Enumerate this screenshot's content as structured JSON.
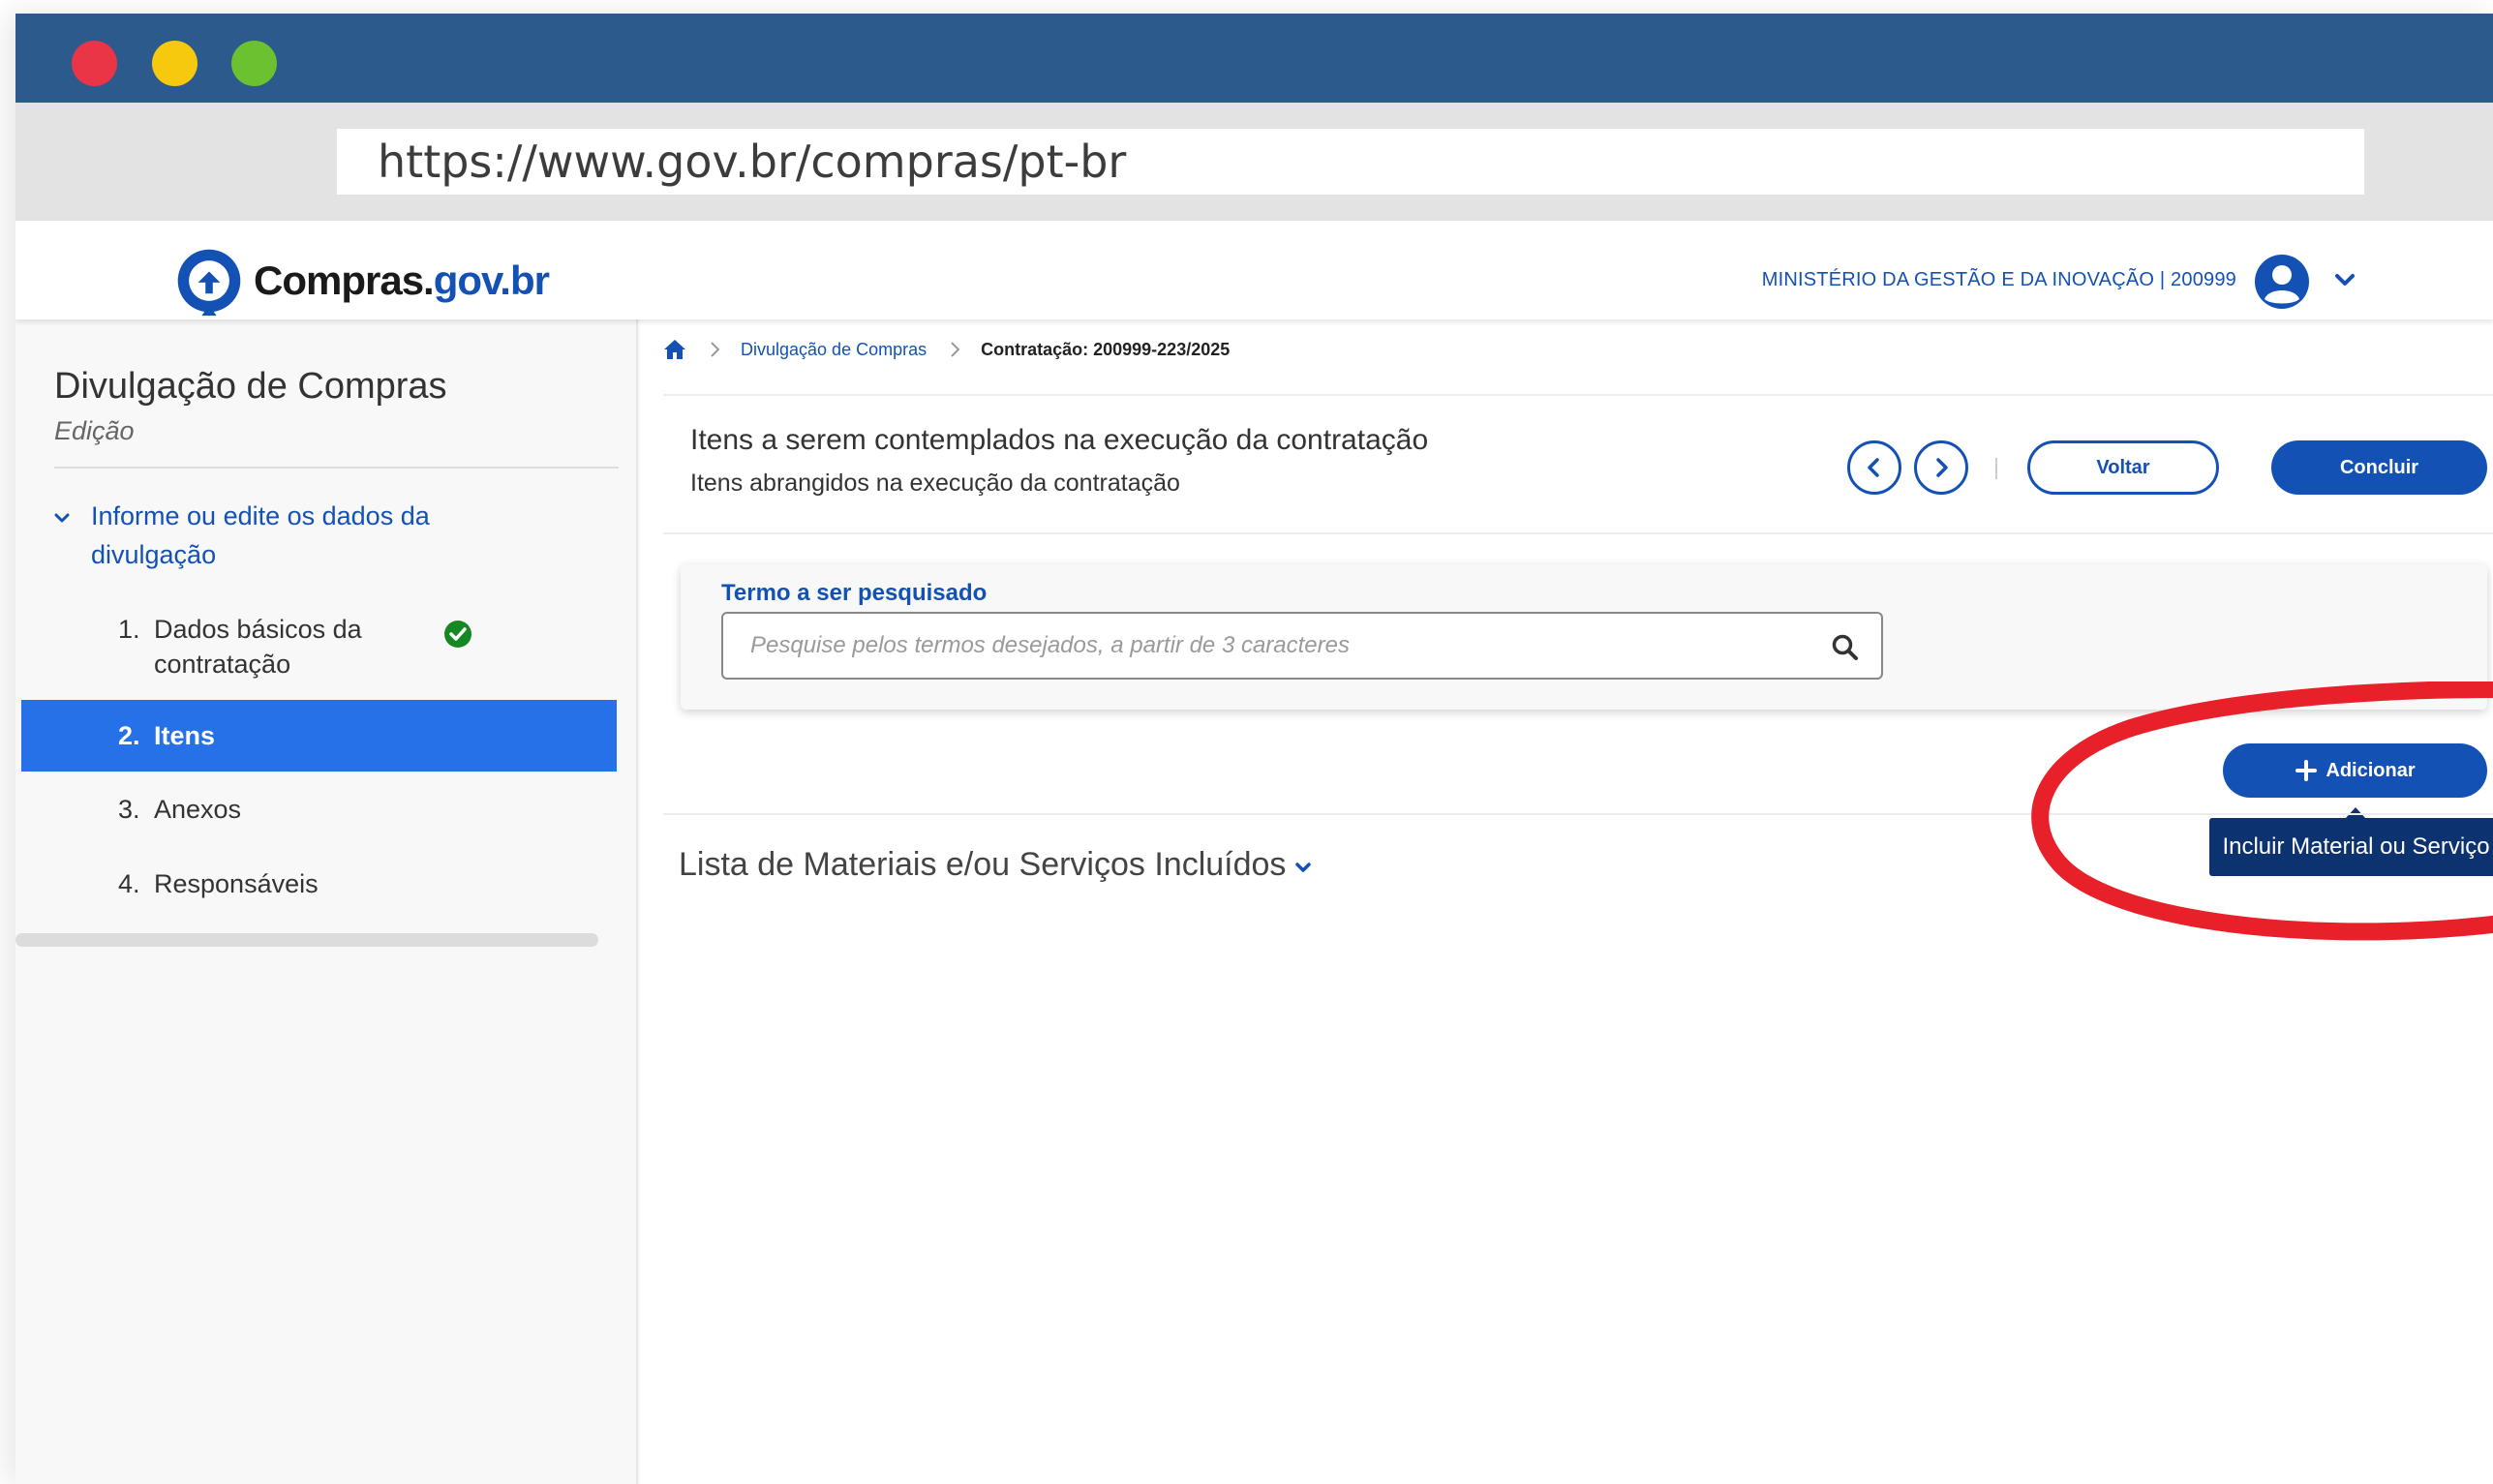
{
  "browser": {
    "url": "https://www.gov.br/compras/pt-br",
    "colors": {
      "titlebar": "#2d5a8c",
      "close": "#ea3546",
      "minimize": "#f6c90e",
      "maximize": "#6cc131"
    }
  },
  "header": {
    "logo_text_main": "Compras.",
    "logo_text_domain": "gov.br",
    "ministry": "MINISTÉRIO DA GESTÃO E DA INOVAÇÃO | 200999",
    "avatar_icon": "user-circle-icon",
    "menu_icon": "chevron-down-icon"
  },
  "sidebar": {
    "title": "Divulgação de Compras",
    "subtitle": "Edição",
    "group_label": "Informe ou edite os dados da divulgação",
    "steps": [
      {
        "num": "1.",
        "label": "Dados básicos da contratação",
        "completed": true
      },
      {
        "num": "2.",
        "label": "Itens",
        "active": true
      },
      {
        "num": "3.",
        "label": "Anexos"
      },
      {
        "num": "4.",
        "label": "Responsáveis"
      }
    ]
  },
  "breadcrumb": {
    "home_icon": "home-icon",
    "items": [
      "Divulgação de Compras",
      "Contratação: 200999-223/2025"
    ]
  },
  "main": {
    "title": "Itens a serem contemplados na execução da contratação",
    "subtitle": "Itens abrangidos na execução da contratação",
    "back_label": "Voltar",
    "finish_label": "Concluir",
    "search": {
      "label": "Termo a ser pesquisado",
      "placeholder": "Pesquise pelos termos desejados, a partir de 3 caracteres",
      "value": ""
    },
    "add_label": "Adicionar",
    "add_tooltip": "Incluir Material ou Serviço",
    "list_title": "Lista de Materiais e/ou Serviços Incluídos"
  },
  "colors": {
    "primary": "#1351b4",
    "active_step": "#2670e8",
    "tooltip": "#0c326f",
    "check": "#168821",
    "highlight": "#e8202a"
  }
}
